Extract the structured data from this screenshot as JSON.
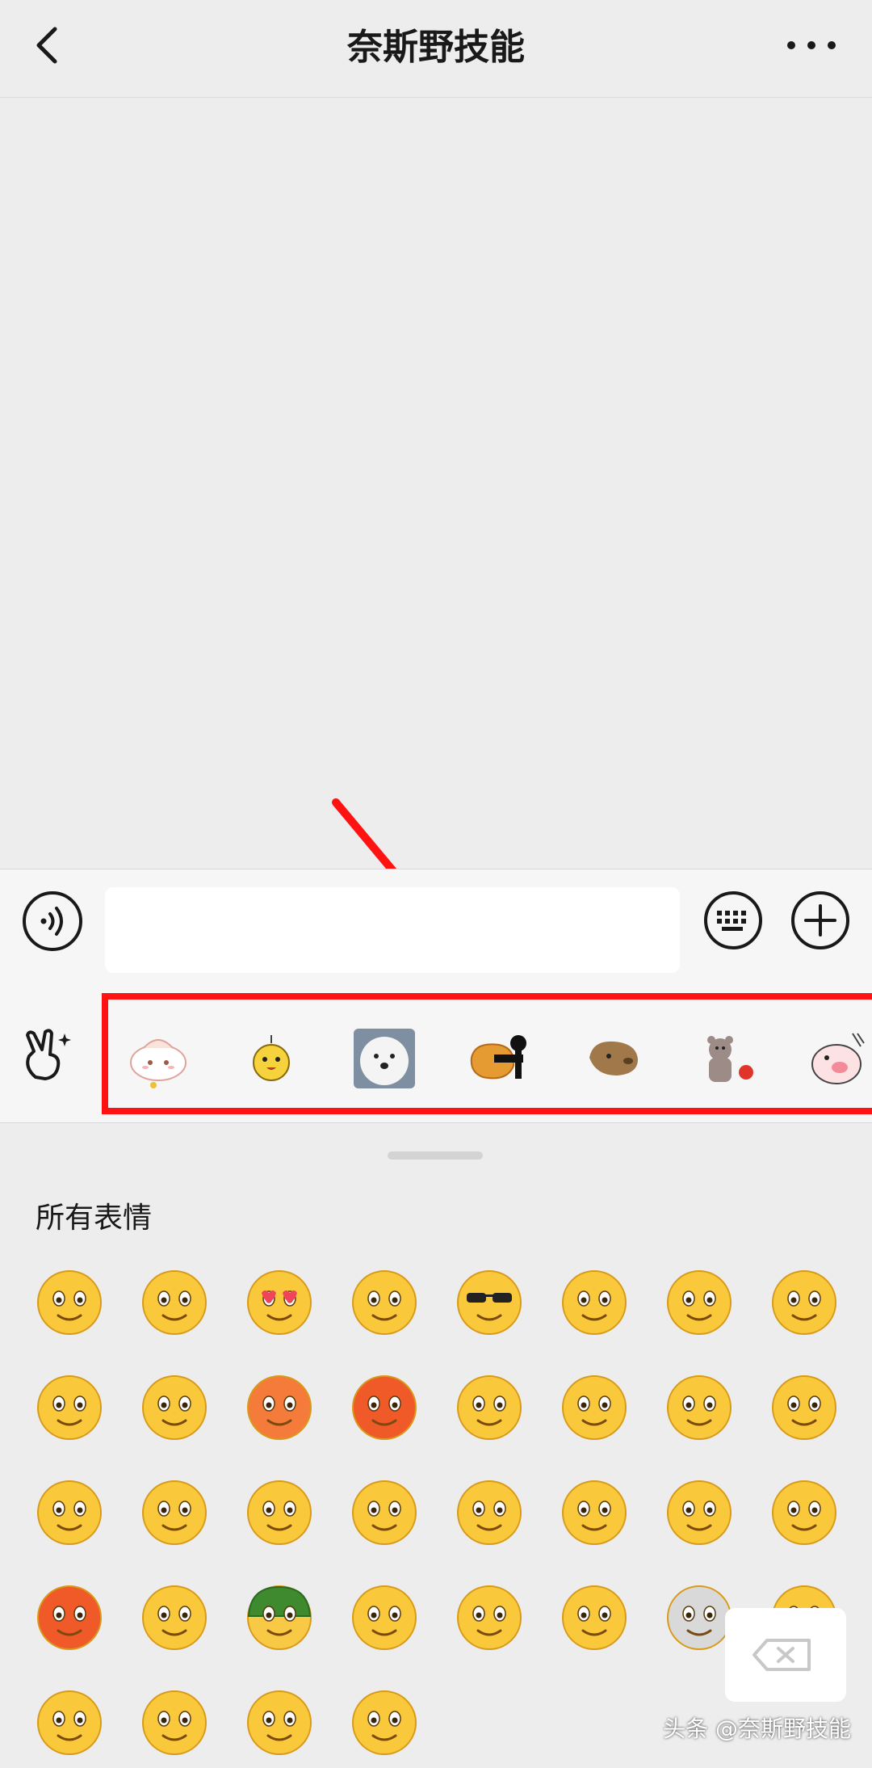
{
  "header": {
    "title": "奈斯野技能",
    "back_icon": "chevron-left-icon",
    "more_icon": "more-dots-icon"
  },
  "input_bar": {
    "voice_icon": "voice-icon",
    "message_value": "",
    "keyboard_icon": "keyboard-icon",
    "plus_icon": "plus-icon"
  },
  "sticker_bar": {
    "gesture_icon": "victory-hand-icon",
    "highlight_color": "#ff1212",
    "stickers": [
      "steamed-bun-sticker",
      "yellow-chick-sticker",
      "samoyed-dog-sticker",
      "fried-chicken-sticker",
      "capybara-sticker",
      "bear-lantern-sticker",
      "pig-sticker"
    ]
  },
  "emoji_panel": {
    "section_title": "所有表情",
    "emojis": [
      "smile",
      "awkward",
      "heart-eyes",
      "stare",
      "cool",
      "loud-cry",
      "shy",
      "mouth-shut",
      "sleep",
      "crying-laugh",
      "embarrassed",
      "angry",
      "wink-tongue",
      "grin",
      "surprised",
      "sad",
      "flushed",
      "laughing-tears",
      "nauseous",
      "chuckle",
      "blush",
      "look-up",
      "eye-roll",
      "meh",
      "frustrated",
      "happy",
      "soldier-helmet",
      "gleeful-cry",
      "confused",
      "hush",
      "skull",
      "frying-pan",
      "thumb-chin",
      "sweat-smirk",
      "pout",
      "smirk-cover"
    ],
    "delete_icon": "backspace-icon"
  },
  "watermark": "头条 @奈斯野技能"
}
